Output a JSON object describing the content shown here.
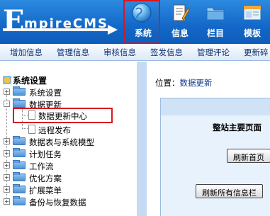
{
  "header": {
    "logo_initial": "E",
    "logo_rest": "mpireCMS",
    "tabs": [
      {
        "label": "系统",
        "icon": "globe-icon",
        "active": true
      },
      {
        "label": "信息",
        "icon": "document-edit-icon",
        "active": false
      },
      {
        "label": "栏目",
        "icon": "folder-icon",
        "active": false
      },
      {
        "label": "模板",
        "icon": "window-template-icon",
        "active": false
      }
    ]
  },
  "subnav": {
    "items": [
      "增加信息",
      "管理信息",
      "审核信息",
      "签发信息",
      "管理评论",
      "更新碎"
    ]
  },
  "sidebar": {
    "title": "系统设置",
    "items": [
      {
        "label": "系统设置",
        "toggle": "+"
      },
      {
        "label": "数据更新",
        "toggle": "-"
      },
      {
        "label": "数据更新中心",
        "leaf": true,
        "highlighted": true
      },
      {
        "label": "远程发布",
        "leaf": true
      },
      {
        "label": "数据表与系统模型",
        "toggle": "+"
      },
      {
        "label": "计划任务",
        "toggle": "+"
      },
      {
        "label": "工作流",
        "toggle": "+"
      },
      {
        "label": "优化方案",
        "toggle": "+"
      },
      {
        "label": "扩展菜单",
        "toggle": "+"
      },
      {
        "label": "备份与恢复数据",
        "toggle": "+"
      }
    ]
  },
  "main": {
    "location_label": "位置：",
    "location_link": "数据更新",
    "panel_heading": "整站主要页面",
    "buttons": [
      "刷新首页",
      "刷新所有信息栏"
    ]
  },
  "colors": {
    "header_blue": "#1368c8",
    "highlight_red": "#d8191f",
    "link_blue": "#0d3a8e"
  }
}
